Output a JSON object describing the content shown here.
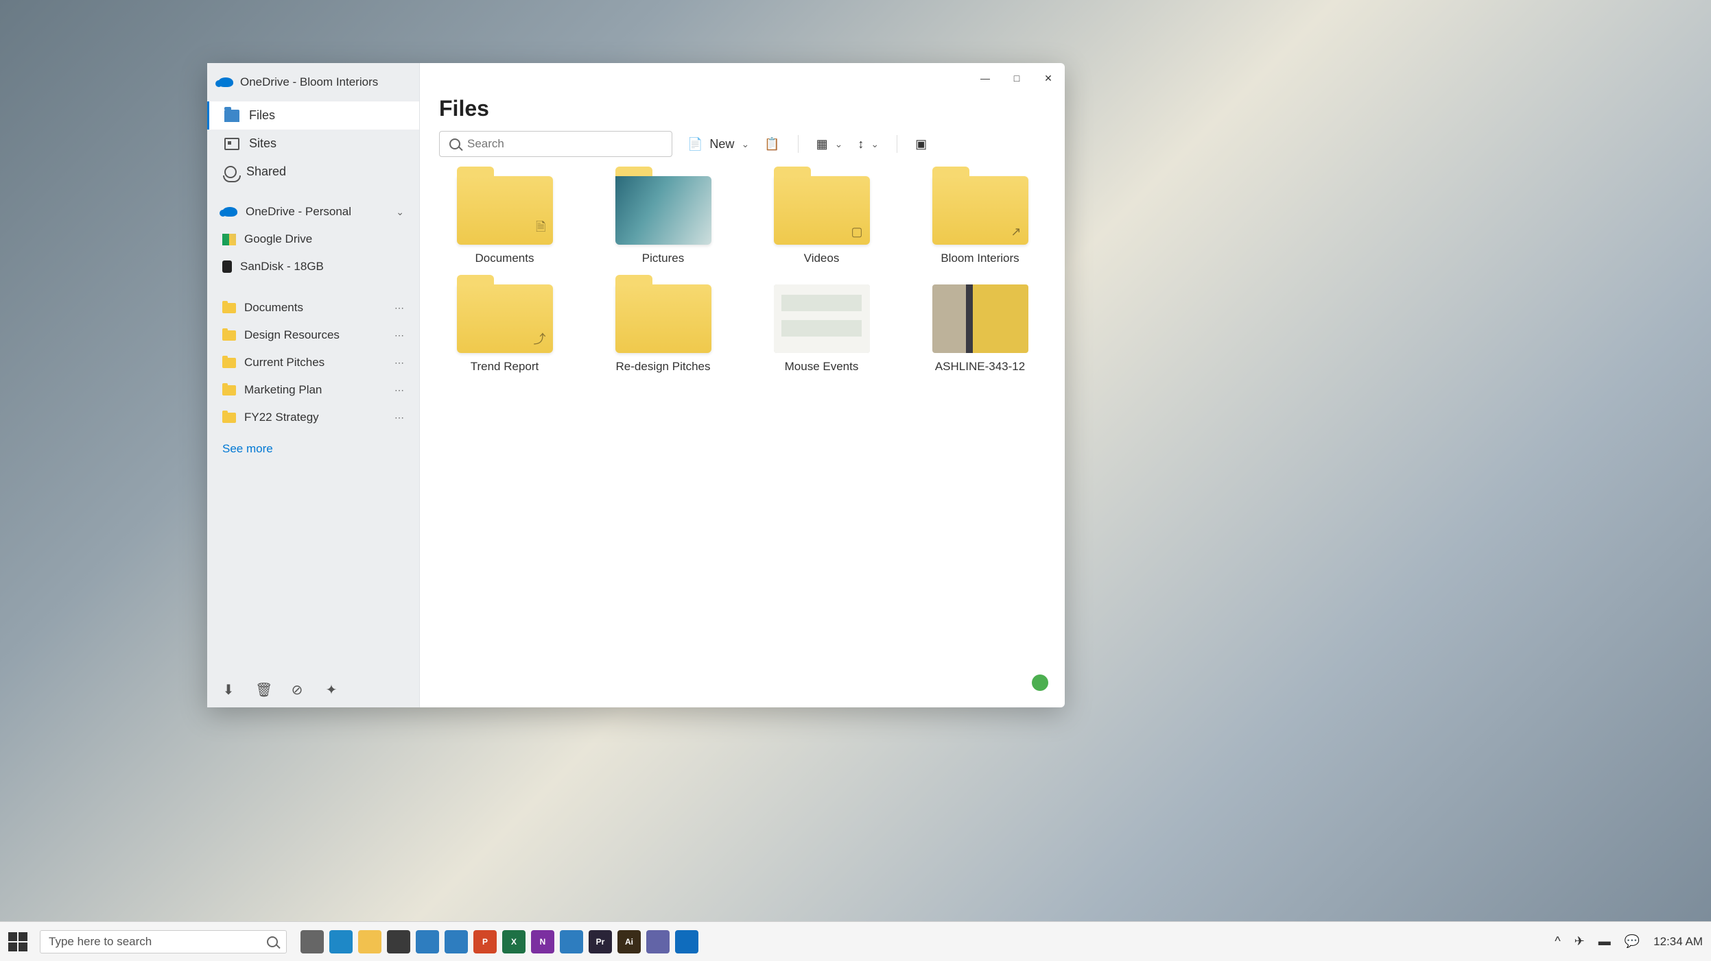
{
  "window": {
    "account": "OneDrive - Bloom Interiors",
    "title": "Files",
    "search_placeholder": "Search",
    "new_label": "New"
  },
  "sidebar": {
    "nav": [
      {
        "label": "Files",
        "active": true
      },
      {
        "label": "Sites",
        "active": false
      },
      {
        "label": "Shared",
        "active": false
      }
    ],
    "accounts": [
      {
        "label": "OneDrive - Personal",
        "expandable": true
      },
      {
        "label": "Google Drive",
        "expandable": false
      },
      {
        "label": "SanDisk - 18GB",
        "expandable": false
      }
    ],
    "pinned": [
      {
        "label": "Documents"
      },
      {
        "label": "Design Resources"
      },
      {
        "label": "Current Pitches"
      },
      {
        "label": "Marketing Plan"
      },
      {
        "label": "FY22 Strategy"
      }
    ],
    "see_more": "See more"
  },
  "files": [
    {
      "name": "Documents",
      "type": "folder",
      "badge": "doc"
    },
    {
      "name": "Pictures",
      "type": "folder-pic",
      "badge": "img"
    },
    {
      "name": "Videos",
      "type": "folder",
      "badge": "vid"
    },
    {
      "name": "Bloom Interiors",
      "type": "folder",
      "badge": "link"
    },
    {
      "name": "Trend Report",
      "type": "folder",
      "badge": "share"
    },
    {
      "name": "Re-design Pitches",
      "type": "folder",
      "badge": ""
    },
    {
      "name": "Mouse Events",
      "type": "thumb-mouse",
      "badge": ""
    },
    {
      "name": "ASHLINE-343-12",
      "type": "thumb-img",
      "badge": ""
    }
  ],
  "taskbar": {
    "search_placeholder": "Type here to search",
    "clock": "12:34 AM",
    "apps": [
      {
        "name": "task-view",
        "bg": "#666",
        "txt": ""
      },
      {
        "name": "edge",
        "bg": "#1e88c7",
        "txt": ""
      },
      {
        "name": "file-explorer",
        "bg": "#f2c14e",
        "txt": ""
      },
      {
        "name": "store",
        "bg": "#3a3a3a",
        "txt": ""
      },
      {
        "name": "mail",
        "bg": "#2e7dbf",
        "txt": ""
      },
      {
        "name": "calendar",
        "bg": "#2e7dbf",
        "txt": ""
      },
      {
        "name": "powerpoint",
        "bg": "#d24726",
        "txt": "P"
      },
      {
        "name": "excel",
        "bg": "#1e7145",
        "txt": "X"
      },
      {
        "name": "onenote",
        "bg": "#7b2fa0",
        "txt": "N"
      },
      {
        "name": "photos",
        "bg": "#2e7dbf",
        "txt": ""
      },
      {
        "name": "premiere",
        "bg": "#2a2438",
        "txt": "Pr"
      },
      {
        "name": "illustrator",
        "bg": "#3a2c18",
        "txt": "Ai"
      },
      {
        "name": "teams",
        "bg": "#6264a7",
        "txt": ""
      },
      {
        "name": "outlook",
        "bg": "#0f6cbd",
        "txt": ""
      }
    ]
  }
}
